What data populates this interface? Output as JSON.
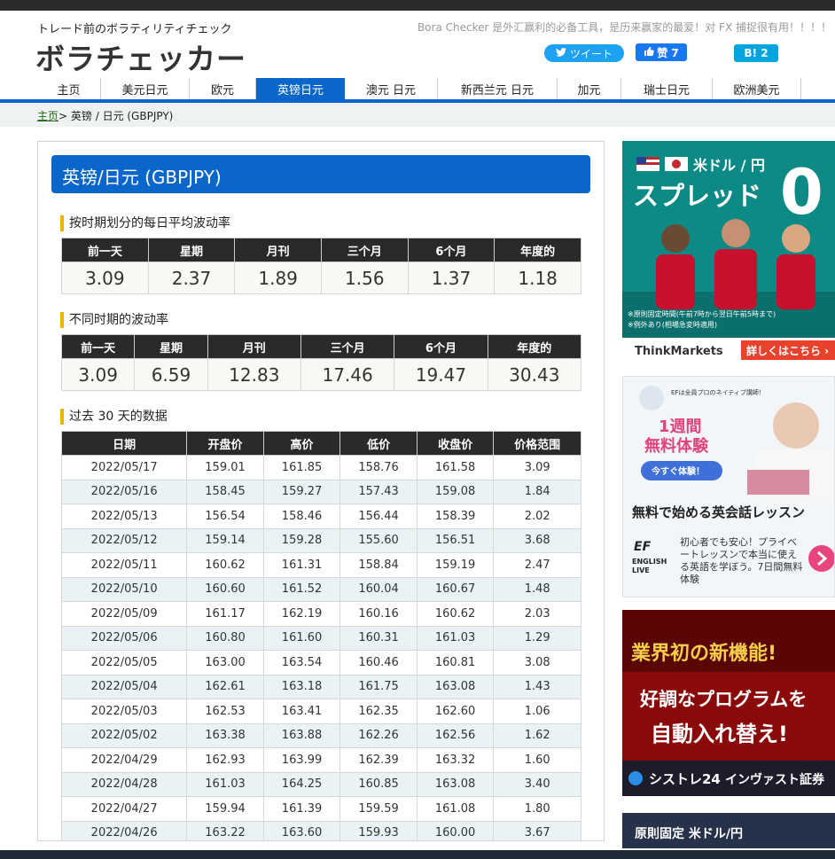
{
  "header": {
    "tagline": "トレード前のボラティリティチェック",
    "logo": "ボラチェッカー",
    "promo": "Bora Checker 是外汇赢利的必备工具，是历来赢家的最爱！对 FX 捕捉很有用！！！！",
    "tweet_label": "ツイート",
    "like_label": "赞 7",
    "hatena_label": "B! 2"
  },
  "nav": {
    "items": [
      "主页",
      "美元日元",
      "欧元",
      "英镑日元",
      "澳元 日元",
      "新西兰元 日元",
      "加元",
      "瑞士日元",
      "欧洲美元"
    ],
    "active": "英镑日元"
  },
  "breadcrumb": {
    "home": "主页",
    "sep": ">",
    "current": " 英镑 / 日元 (GBPJPY)"
  },
  "page_title": "英镑/日元 (GBPJPY)",
  "avg_volatility": {
    "heading": "按时期划分的每日平均波动率",
    "headers": [
      "前一天",
      "星期",
      "月刊",
      "三个月",
      "6个月",
      "年度的"
    ],
    "values": [
      "3.09",
      "2.37",
      "1.89",
      "1.56",
      "1.37",
      "1.18"
    ]
  },
  "period_volatility": {
    "heading": "不同时期的波动率",
    "headers": [
      "前一天",
      "星期",
      "月刊",
      "三个月",
      "6个月",
      "年度的"
    ],
    "values": [
      "3.09",
      "6.59",
      "12.83",
      "17.46",
      "19.47",
      "30.43"
    ]
  },
  "daily": {
    "heading": "过去 30 天的数据",
    "headers": [
      "日期",
      "开盘价",
      "高价",
      "低价",
      "收盘价",
      "价格范围"
    ],
    "rows": [
      [
        "2022/05/17",
        "159.01",
        "161.85",
        "158.76",
        "161.58",
        "3.09"
      ],
      [
        "2022/05/16",
        "158.45",
        "159.27",
        "157.43",
        "159.08",
        "1.84"
      ],
      [
        "2022/05/13",
        "156.54",
        "158.46",
        "156.44",
        "158.39",
        "2.02"
      ],
      [
        "2022/05/12",
        "159.14",
        "159.28",
        "155.60",
        "156.51",
        "3.68"
      ],
      [
        "2022/05/11",
        "160.62",
        "161.31",
        "158.84",
        "159.19",
        "2.47"
      ],
      [
        "2022/05/10",
        "160.60",
        "161.52",
        "160.04",
        "160.67",
        "1.48"
      ],
      [
        "2022/05/09",
        "161.17",
        "162.19",
        "160.16",
        "160.62",
        "2.03"
      ],
      [
        "2022/05/06",
        "160.80",
        "161.60",
        "160.31",
        "161.03",
        "1.29"
      ],
      [
        "2022/05/05",
        "163.00",
        "163.54",
        "160.46",
        "160.81",
        "3.08"
      ],
      [
        "2022/05/04",
        "162.61",
        "163.18",
        "161.75",
        "163.08",
        "1.43"
      ],
      [
        "2022/05/03",
        "162.53",
        "163.41",
        "162.35",
        "162.60",
        "1.06"
      ],
      [
        "2022/05/02",
        "163.38",
        "163.88",
        "162.26",
        "162.56",
        "1.62"
      ],
      [
        "2022/04/29",
        "162.93",
        "163.99",
        "162.39",
        "163.32",
        "1.60"
      ],
      [
        "2022/04/28",
        "161.03",
        "164.25",
        "160.85",
        "163.08",
        "3.40"
      ],
      [
        "2022/04/27",
        "159.94",
        "161.39",
        "159.59",
        "161.08",
        "1.80"
      ],
      [
        "2022/04/26",
        "163.22",
        "163.60",
        "159.93",
        "160.00",
        "3.67"
      ]
    ]
  },
  "ads": {
    "ad1": {
      "line1": "米ドル / 円",
      "line2": "スプレッド",
      "digit": "0",
      "note1": "※原則固定時間(午前7時から翌日午前5時まで)",
      "note2": "※例外あり(相場急変時適用)",
      "brand": "ThinkMarkets",
      "cta": "詳しくはこちら ›"
    },
    "ad2": {
      "top": "EFは全員プロのネイティブ講師！",
      "big1": "1週間",
      "big2": "無料体験",
      "btn": "今すぐ体験！",
      "headline": "無料で始める英会話レッスン",
      "brand1": "EF",
      "brand2": "ENGLISH",
      "brand3": "LIVE",
      "desc": "初心者でも安心！プライベートレッスンで本当に使える英語を学ぼう。7日間無料体験"
    },
    "ad3": {
      "line1": "業界初の新機能!",
      "line2": "好調なプログラムを",
      "line3": "自動入れ替え!",
      "brand": "シストレ24",
      "tail": "インヴァスト証券"
    },
    "ad4": {
      "text": "原則固定 米ドル/円"
    }
  },
  "colors": {
    "accent": "#0a66c8",
    "section_bar": "#f0b400",
    "table_head": "#2a2a2a",
    "row_alt": "#e9f2f5"
  }
}
